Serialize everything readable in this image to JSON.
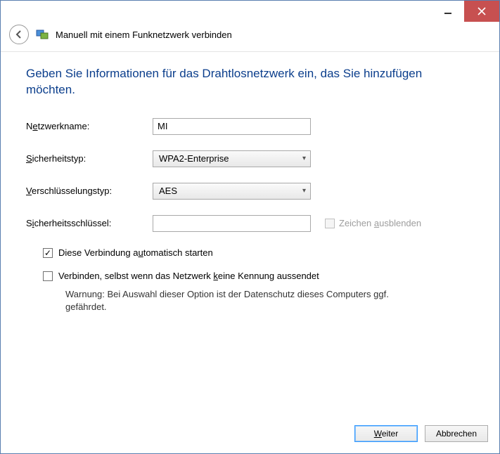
{
  "header": {
    "title": "Manuell mit einem Funknetzwerk verbinden"
  },
  "instruction": "Geben Sie Informationen für das Drahtlosnetzwerk ein, das Sie hinzufügen möchten.",
  "form": {
    "network_name_label_pre": "N",
    "network_name_label_accel": "e",
    "network_name_label_post": "tzwerkname:",
    "network_name_value": "MI",
    "security_type_label_accel": "S",
    "security_type_label_post": "icherheitstyp:",
    "security_type_value": "WPA2-Enterprise",
    "encryption_type_label_accel": "V",
    "encryption_type_label_post": "erschlüsselungstyp:",
    "encryption_type_value": "AES",
    "security_key_label_pre": "S",
    "security_key_label_accel": "i",
    "security_key_label_post": "cherheitsschlüssel:",
    "security_key_value": "",
    "hide_chars_pre": "Zeichen ",
    "hide_chars_accel": "a",
    "hide_chars_post": "usblenden"
  },
  "checkboxes": {
    "auto_start_pre": "Diese Verbindung a",
    "auto_start_accel": "u",
    "auto_start_post": "tomatisch starten",
    "auto_start_checked": true,
    "connect_hidden_pre": "Verbinden, selbst wenn das Netzwerk ",
    "connect_hidden_accel": "k",
    "connect_hidden_post": "eine Kennung aussendet",
    "connect_hidden_checked": false,
    "warning": "Warnung: Bei Auswahl dieser Option ist der Datenschutz dieses Computers ggf. gefährdet."
  },
  "buttons": {
    "next_accel": "W",
    "next_post": "eiter",
    "cancel": "Abbrechen"
  }
}
